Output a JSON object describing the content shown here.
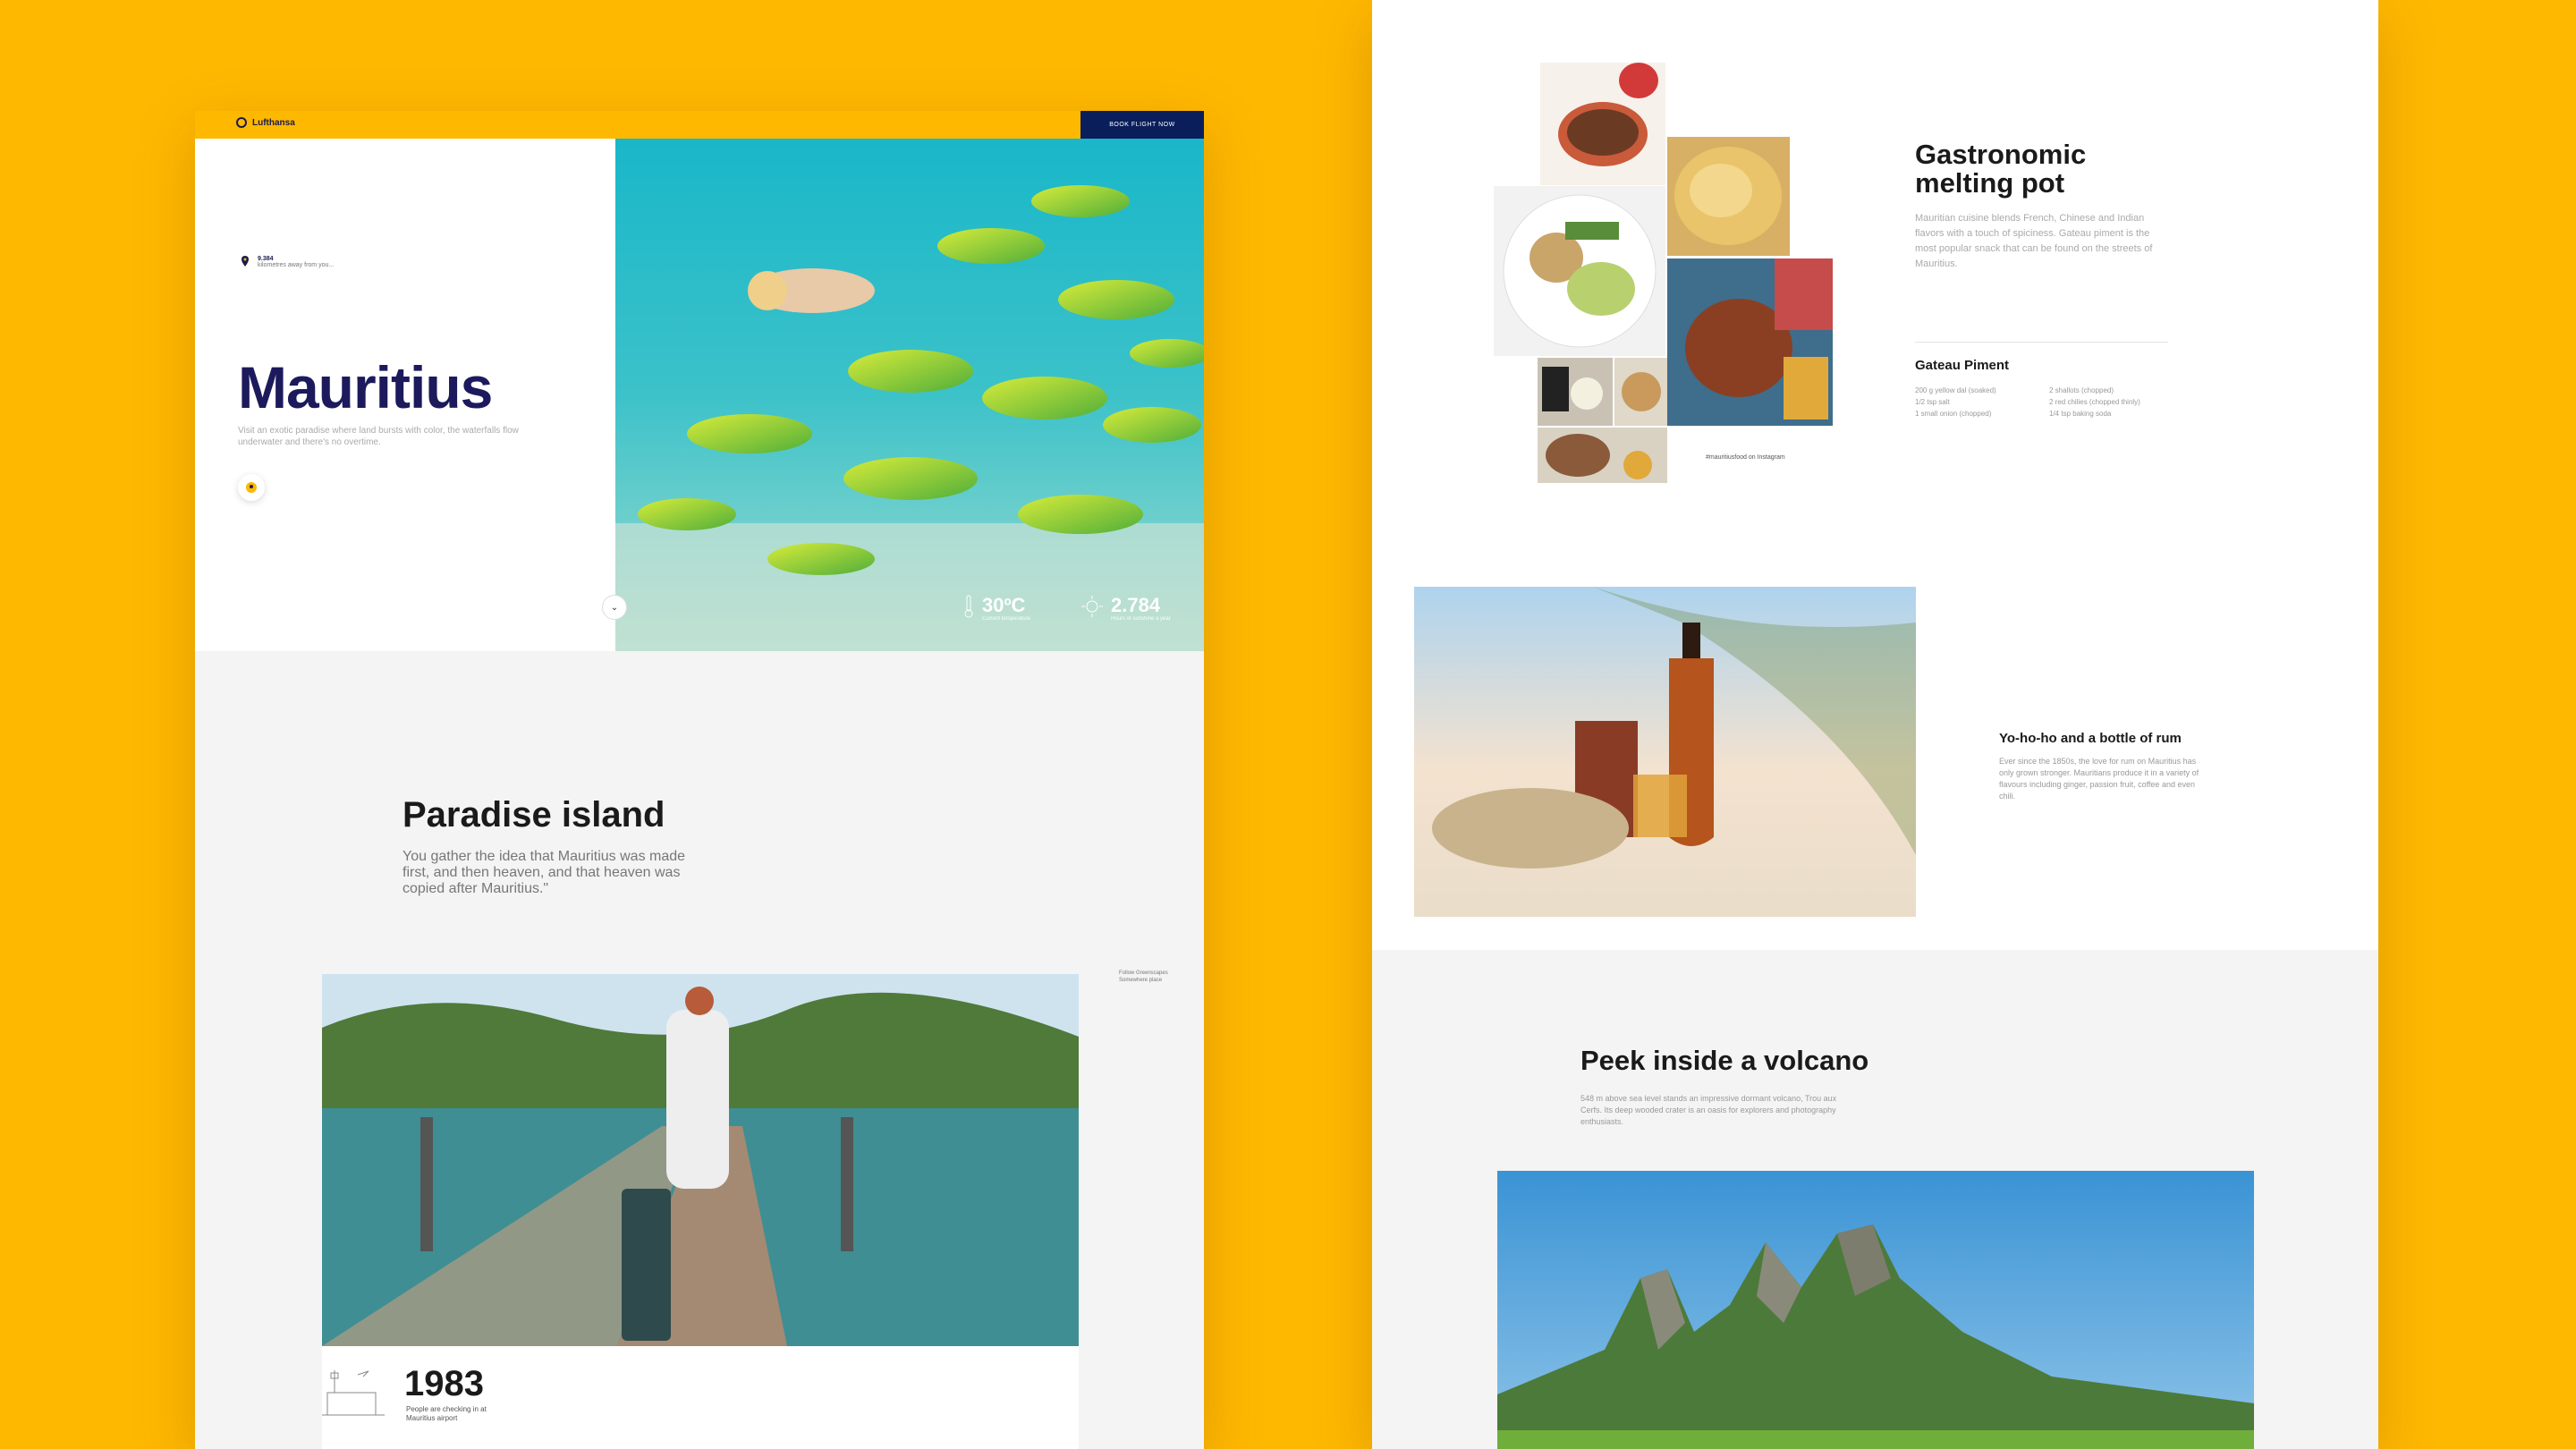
{
  "brand": {
    "name": "Lufthansa"
  },
  "header": {
    "book_label": "BOOK FLIGHT NOW"
  },
  "hero": {
    "distance_value": "9.384",
    "distance_label": "kilometres away from you...",
    "title": "Mauritius",
    "description": "Visit an exotic paradise where land bursts with color, the waterfalls flow underwater and there's no overtime.",
    "temperature": "30ºC",
    "temperature_label": "Current temperature",
    "sunshine": "2.784",
    "sunshine_label": "Hours of sunshine a year"
  },
  "paradise": {
    "title": "Paradise island",
    "quote": "You gather the idea that Mauritius was made first, and then heaven, and that heaven was copied after Mauritius.\""
  },
  "photo_caption": {
    "line1": "Follow Greenscapes",
    "line2": "Somewhere place"
  },
  "airport_stat": {
    "year": "1983",
    "label": "People are checking in at Mauritius airport"
  },
  "gastronomy": {
    "title": "Gastronomic melting pot",
    "description": "Mauritian cuisine blends French, Chinese and Indian flavors with a touch of spiciness. Gateau piment is the most popular snack that can be found on the streets of Mauritius.",
    "instagram_caption": "#mauritiusfood on Instagram",
    "recipe_title": "Gateau Piment",
    "ingredients": [
      "200 g yellow dal (soaked)",
      "2 shallots (chopped)",
      "1/2 tsp salt",
      "2 red chilies (chopped thinly)",
      "1 small onion (chopped)",
      "1/4 tsp baking soda"
    ]
  },
  "rum": {
    "title": "Yo-ho-ho and a bottle of rum",
    "description": "Ever since the 1850s, the love for rum on Mauritius has only grown stronger. Mauritians produce it in a variety of flavours including ginger, passion fruit, coffee and even chili."
  },
  "volcano": {
    "title": "Peek inside a volcano",
    "description": "548 m above sea level stands an impressive dormant volcano, Trou aux Cerfs. Its deep wooded crater is an oasis for explorers and photography enthusiasts."
  },
  "colors": {
    "accent": "#FFB800",
    "navy": "#0a1e5c",
    "title": "#1c1a5c"
  }
}
